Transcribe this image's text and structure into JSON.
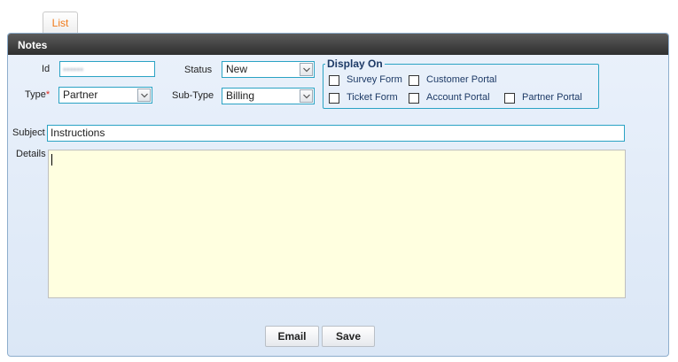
{
  "tabs": [
    {
      "label": "List"
    }
  ],
  "panel": {
    "title": "Notes"
  },
  "form": {
    "id": {
      "label": "Id",
      "value": "••••••"
    },
    "type": {
      "label": "Type",
      "required_mark": "*",
      "value": "Partner"
    },
    "status": {
      "label": "Status",
      "value": "New"
    },
    "subtype": {
      "label": "Sub-Type",
      "value": "Billing"
    },
    "subject": {
      "label": "Subject",
      "value": "Instructions"
    },
    "details": {
      "label": "Details",
      "value": ""
    }
  },
  "display_on": {
    "legend": "Display On",
    "options": [
      {
        "label": "Survey Form",
        "checked": false
      },
      {
        "label": "Customer Portal",
        "checked": false
      },
      {
        "label": "Ticket Form",
        "checked": false
      },
      {
        "label": "Account Portal",
        "checked": false
      },
      {
        "label": "Partner Portal",
        "checked": false
      }
    ]
  },
  "buttons": {
    "email": "Email",
    "save": "Save"
  },
  "colors": {
    "tab_active_text": "#f07a1a",
    "field_border": "#2ba3c4",
    "details_bg": "#ffffe0",
    "required": "#e0261b"
  }
}
